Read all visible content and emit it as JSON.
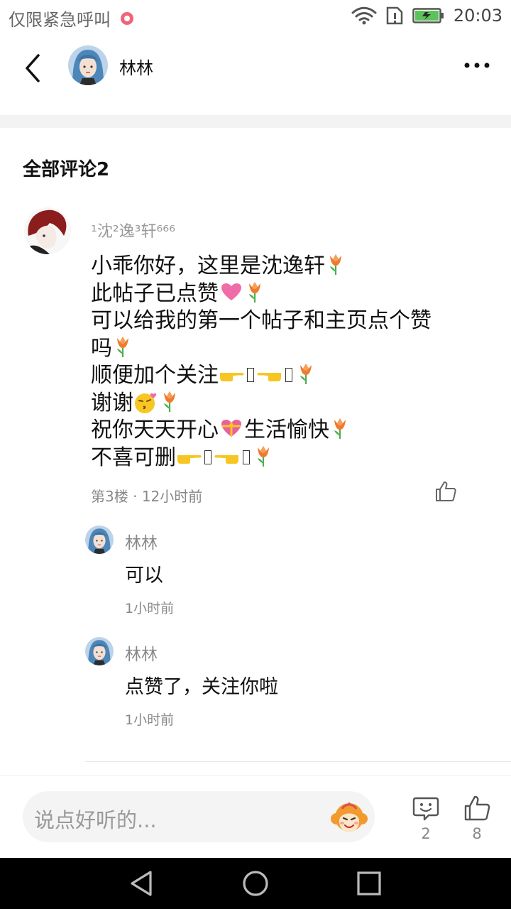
{
  "status_bar": {
    "carrier": "仅限紧急呼叫",
    "time": "20:03"
  },
  "header": {
    "title": "林林"
  },
  "comments_section": {
    "title": "全部评论2"
  },
  "comment": {
    "author": "¹沈²逸³轩⁶⁶⁶",
    "lines": [
      "小乖你好，这里是沈逸轩",
      "此帖子已点赞",
      "可以给我的第一个帖子和主页点个赞",
      "吗",
      "顺便加个关注",
      "谢谢",
      "祝你天天开心",
      "生活愉快",
      "不喜可删"
    ],
    "floor": "第3楼",
    "time": "12小时前"
  },
  "replies": [
    {
      "author": "林林",
      "text": "可以",
      "time": "1小时前"
    },
    {
      "author": "林林",
      "text": "点赞了，关注你啦",
      "time": "1小时前"
    }
  ],
  "bottom_bar": {
    "placeholder": "说点好听的...",
    "comment_count": "2",
    "like_count": "8"
  },
  "colors": {
    "tulip_orange": "#f07a2d",
    "pink_heart": "#f06ca8",
    "emoji_yellow": "#f7c623",
    "meta_gray": "#888888"
  }
}
